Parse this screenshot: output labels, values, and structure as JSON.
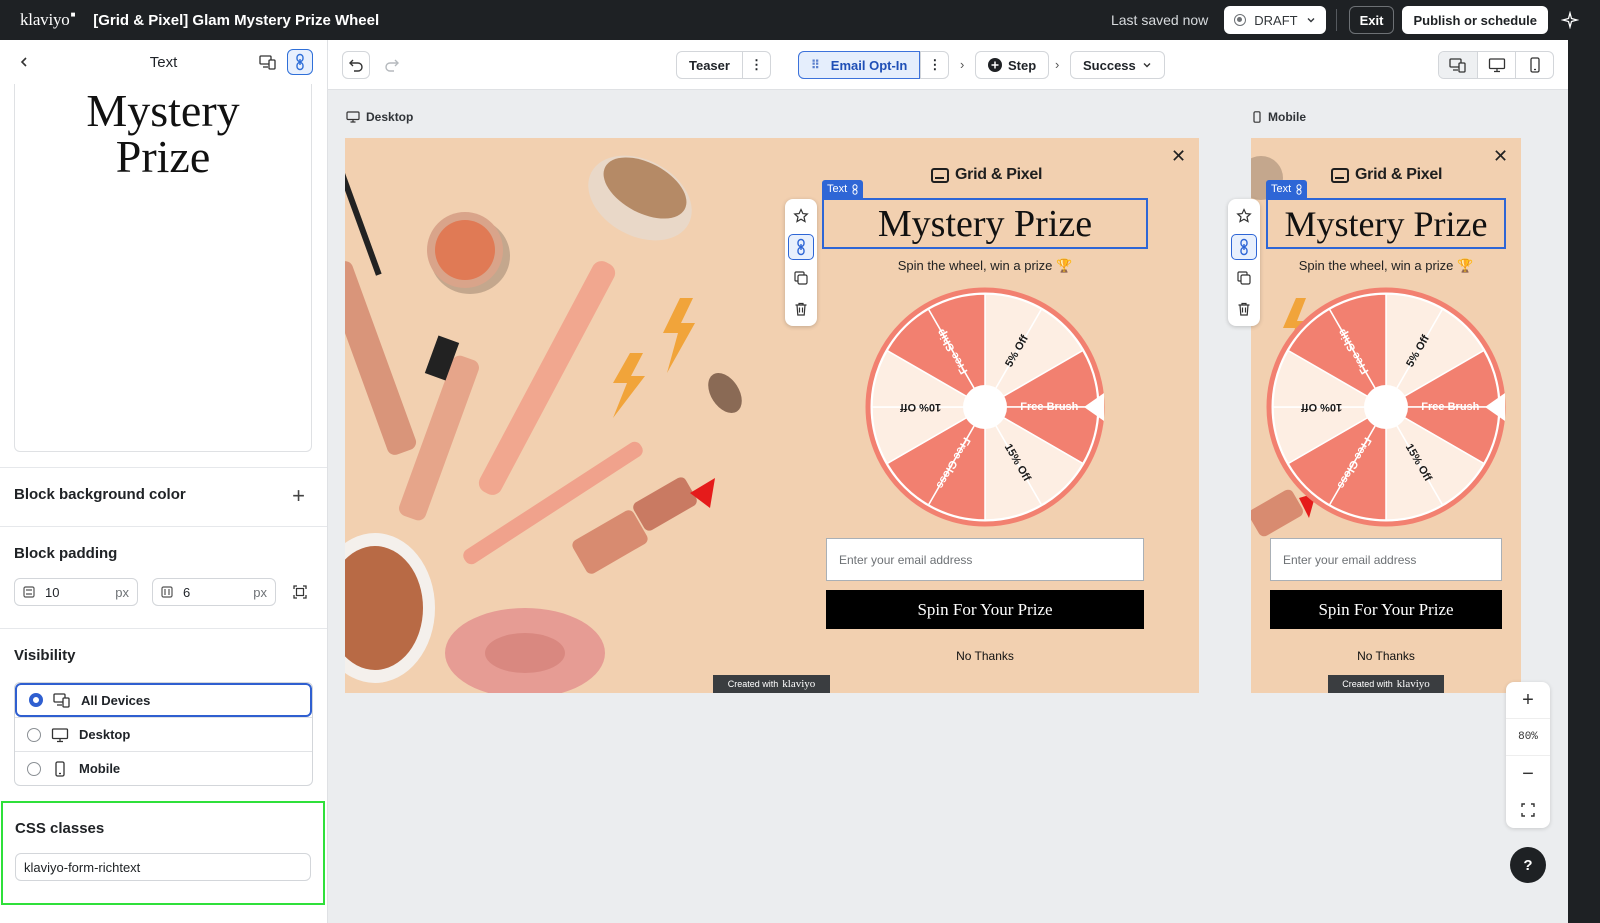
{
  "topbar": {
    "logo": "klaviyo",
    "form_title": "[Grid & Pixel] Glam Mystery Prize Wheel",
    "saved_status": "Last saved now",
    "status": "DRAFT",
    "exit_label": "Exit",
    "publish_label": "Publish or schedule"
  },
  "left_panel": {
    "title": "Text",
    "preview_line1": "Mystery",
    "preview_line2": "Prize",
    "bg_color_label": "Block background color",
    "padding_label": "Block padding",
    "padding_vertical": "10",
    "padding_horizontal": "6",
    "unit": "px",
    "visibility_label": "Visibility",
    "visibility_options": [
      {
        "label": "All Devices",
        "selected": true
      },
      {
        "label": "Desktop",
        "selected": false
      },
      {
        "label": "Mobile",
        "selected": false
      }
    ],
    "css_label": "CSS classes",
    "css_value": "klaviyo-form-richtext"
  },
  "toolbar": {
    "steps": [
      "Teaser",
      "Email Opt-In",
      "Step",
      "Success"
    ],
    "active_step": "Email Opt-In"
  },
  "canvas": {
    "desktop_label": "Desktop",
    "mobile_label": "Mobile",
    "popup": {
      "brand": "Grid & Pixel",
      "text_tag": "Text",
      "title": "Mystery Prize",
      "subtitle": "Spin the wheel, win a prize 🏆",
      "wheel_segments": [
        "5% Off",
        "Free Brush",
        "15% Off",
        "Free Gloss",
        "10% Off",
        "Free Ship"
      ],
      "email_placeholder": "Enter your email address",
      "button_label": "Spin For Your Prize",
      "decline_label": "No Thanks",
      "created_with": "Created with",
      "created_brand": "klaviyo"
    },
    "zoom": "80%"
  },
  "help_label": "?",
  "colors": {
    "popup_bg": "#f2d0b0",
    "wheel_coral": "#f28070",
    "wheel_cream": "#fdeee3",
    "selection_blue": "#2e66d6",
    "highlight_green": "#2fe03a"
  }
}
